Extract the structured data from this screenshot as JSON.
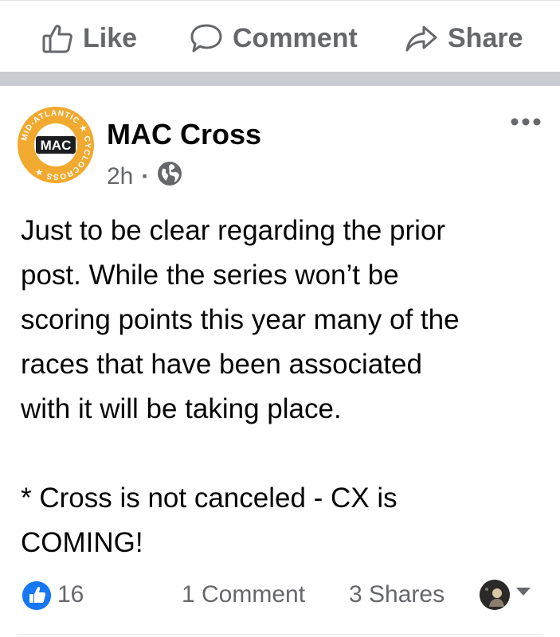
{
  "actions": {
    "like_label": "Like",
    "comment_label": "Comment",
    "share_label": "Share"
  },
  "post": {
    "author": "MAC Cross",
    "time": "2h",
    "audience_icon": "globe-icon",
    "avatar_logo": {
      "badge_text": "MAC",
      "ring_text": "MID-ATLANTIC ★ CYCLOCROSS ★",
      "color": "#f1a92f"
    },
    "body_lines": [
      "Just to be clear regarding the prior",
      "post. While the series won’t be",
      "scoring points this year many of the",
      "races that have been associated",
      "with it will be taking place."
    ],
    "body_lines_2": [
      "* Cross is not canceled - CX is",
      "COMING!"
    ]
  },
  "stats": {
    "likes": "16",
    "comments": "1 Comment",
    "shares": "3 Shares"
  },
  "colors": {
    "divider": "#c9ccd1",
    "secondary_text": "#65676b",
    "like_blue": "#1877f2"
  }
}
